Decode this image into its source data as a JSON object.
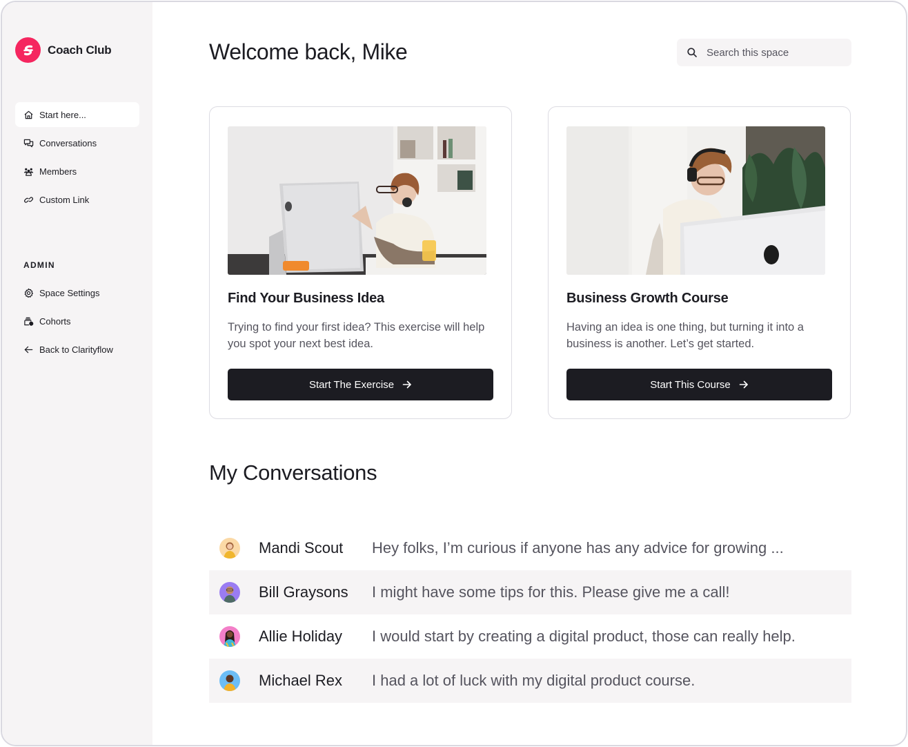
{
  "brand": {
    "name": "Coach Club",
    "color": "#f5265f"
  },
  "sidebar": {
    "items": [
      {
        "label": "Start here...",
        "icon": "home-icon",
        "active": true
      },
      {
        "label": "Conversations",
        "icon": "chat-bubbles-icon"
      },
      {
        "label": "Members",
        "icon": "members-icon"
      },
      {
        "label": "Custom Link",
        "icon": "link-icon"
      }
    ],
    "admin_label": "ADMIN",
    "admin_items": [
      {
        "label": "Space Settings",
        "icon": "gear-icon"
      },
      {
        "label": "Cohorts",
        "icon": "cohorts-icon"
      },
      {
        "label": "Back to Clarityflow",
        "icon": "arrow-left-icon"
      }
    ]
  },
  "header": {
    "title": "Welcome back, Mike",
    "search_placeholder": "Search this space"
  },
  "cards": [
    {
      "title": "Find Your Business Idea",
      "description": "Trying to find your first idea? This exercise will help you spot your next best idea.",
      "button": "Start The Exercise",
      "image": "woman with headphones gesturing at desktop computer"
    },
    {
      "title": "Business Growth Course",
      "description": "Having an idea is one thing, but turning it into a business is another. Let’s get started.",
      "button": "Start This Course",
      "image": "woman with headphones working at desktop computer near plants"
    }
  ],
  "conversations": {
    "title": "My Conversations",
    "items": [
      {
        "name": "Mandi Scout",
        "message": "Hey folks, I’m curious if anyone has any advice for growing ...",
        "avatar_bg": "#fbd9a6"
      },
      {
        "name": "Bill Graysons",
        "message": "I might have some tips for this. Please give me a call!",
        "avatar_bg": "#9a7cf2"
      },
      {
        "name": "Allie Holiday",
        "message": "I would start by creating a digital product, those can really help.",
        "avatar_bg": "#f37fc8"
      },
      {
        "name": "Michael Rex",
        "message": "I had a lot of luck with my digital product course.",
        "avatar_bg": "#6cbdf5"
      }
    ]
  }
}
